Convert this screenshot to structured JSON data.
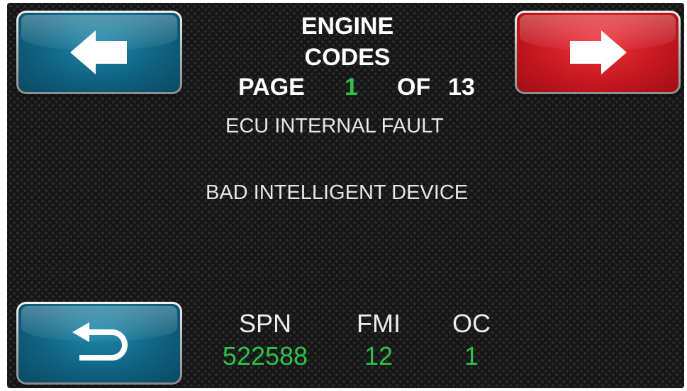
{
  "colors": {
    "background": "#161616",
    "accent_green": "#2fc24a",
    "prev_button": "#0e5f7e",
    "next_button": "#c4161e",
    "back_button": "#0e5f7e",
    "text": "#ffffff"
  },
  "header": {
    "title_line1": "ENGINE",
    "title_line2": "CODES",
    "page_label": "PAGE",
    "page_current": "1",
    "page_of": "OF",
    "page_total": "13"
  },
  "buttons": {
    "prev": {
      "icon": "arrow-left-icon"
    },
    "next": {
      "icon": "arrow-right-icon"
    },
    "back": {
      "icon": "return-icon"
    }
  },
  "fault": {
    "description_1": "ECU INTERNAL FAULT",
    "description_2": "BAD INTELLIGENT DEVICE"
  },
  "codes": {
    "spn_label": "SPN",
    "spn_value": "522588",
    "fmi_label": "FMI",
    "fmi_value": "12",
    "oc_label": "OC",
    "oc_value": "1"
  }
}
